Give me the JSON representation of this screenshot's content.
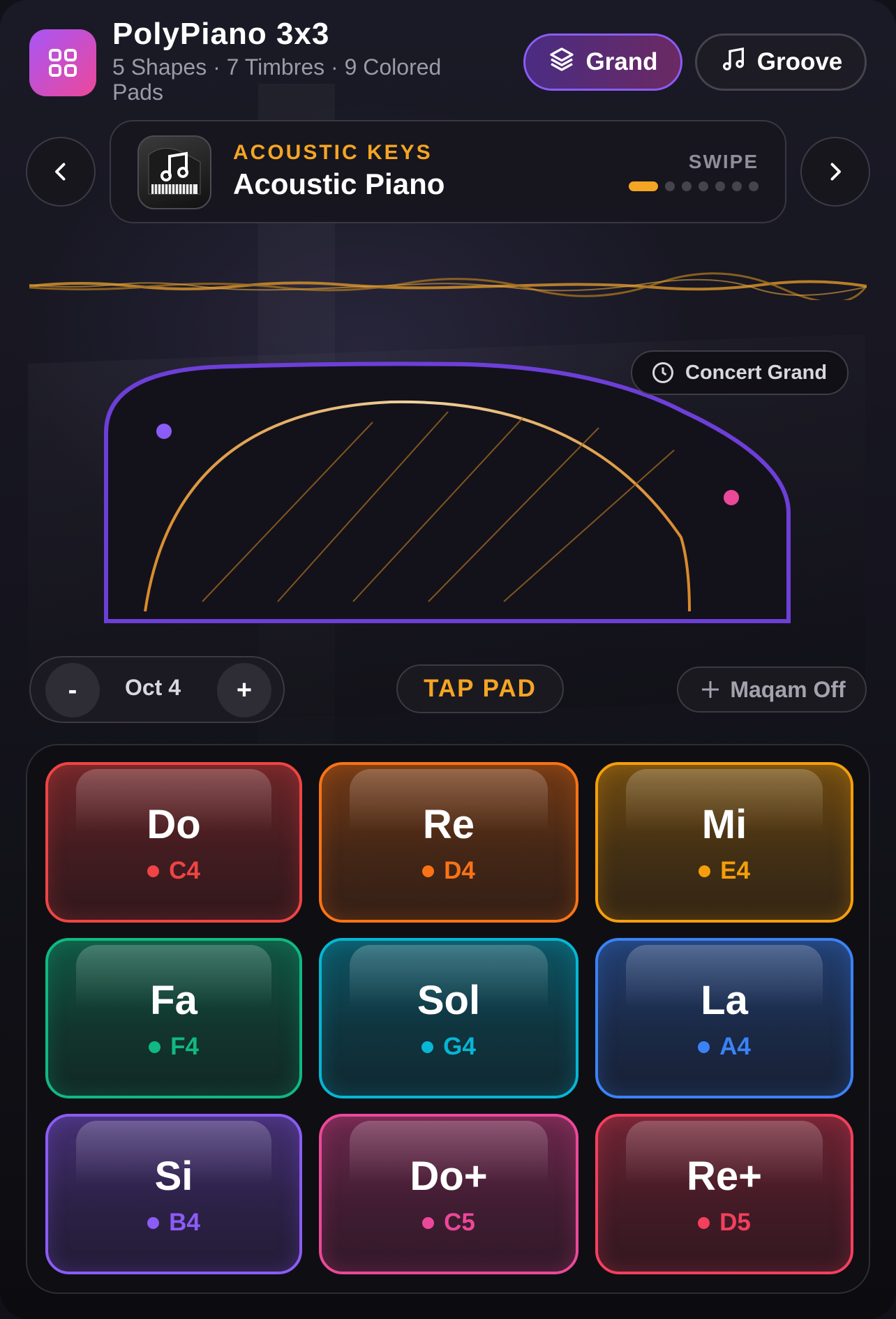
{
  "header": {
    "title": "PolyPiano 3x3",
    "subtitle": "5 Shapes · 7 Timbres · 9 Colored Pads",
    "modes": [
      {
        "label": "Grand",
        "icon": "layers-icon",
        "active": true
      },
      {
        "label": "Groove",
        "icon": "music-note-icon",
        "active": false
      }
    ]
  },
  "instrument": {
    "category": "ACOUSTIC KEYS",
    "name": "Acoustic Piano",
    "swipe_label": "SWIPE",
    "page_count": 7,
    "active_page": 1
  },
  "visual": {
    "preset_label": "Concert Grand",
    "accent": "#f5a524",
    "outline": "#6d3fd8"
  },
  "controls": {
    "octave_minus": "-",
    "octave_label": "Oct 4",
    "octave_plus": "+",
    "tap_pad": "TAP PAD",
    "maqam": "Maqam Off"
  },
  "pads": [
    {
      "solfege": "Do",
      "note": "C4",
      "color": "#ef4444"
    },
    {
      "solfege": "Re",
      "note": "D4",
      "color": "#f97316"
    },
    {
      "solfege": "Mi",
      "note": "E4",
      "color": "#f59e0b"
    },
    {
      "solfege": "Fa",
      "note": "F4",
      "color": "#10b981"
    },
    {
      "solfege": "Sol",
      "note": "G4",
      "color": "#06b6d4"
    },
    {
      "solfege": "La",
      "note": "A4",
      "color": "#3b82f6"
    },
    {
      "solfege": "Si",
      "note": "B4",
      "color": "#8b5cf6"
    },
    {
      "solfege": "Do+",
      "note": "C5",
      "color": "#ec4899"
    },
    {
      "solfege": "Re+",
      "note": "D5",
      "color": "#f43f5e"
    }
  ]
}
